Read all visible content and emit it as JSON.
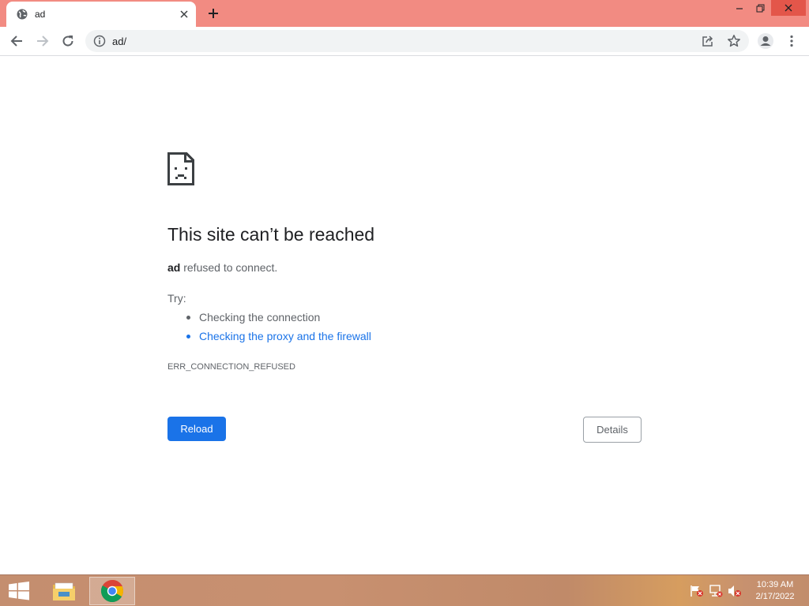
{
  "browser": {
    "tab": {
      "title": "ad",
      "favicon": "globe-icon"
    },
    "address": {
      "url": "ad/"
    },
    "colors": {
      "frame": "#f28b82",
      "accent": "#1a73e8"
    }
  },
  "error_page": {
    "headline": "This site can’t be reached",
    "host": "ad",
    "message": " refused to connect.",
    "try_label": "Try:",
    "suggestions": [
      "Checking the connection",
      "Checking the proxy and the firewall"
    ],
    "error_code": "ERR_CONNECTION_REFUSED",
    "reload_label": "Reload",
    "details_label": "Details"
  },
  "taskbar": {
    "time": "10:39 AM",
    "date": "2/17/2022",
    "apps": [
      "file-explorer-icon",
      "chrome-icon"
    ]
  }
}
